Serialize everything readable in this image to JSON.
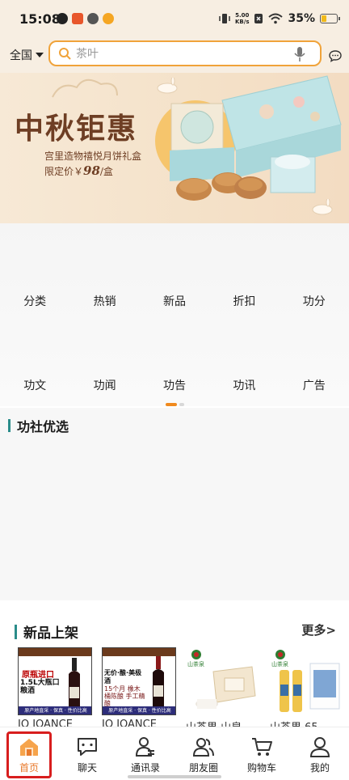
{
  "status_bar": {
    "time": "15:08",
    "net_speed_value": "5.00",
    "net_speed_unit": "KB/s",
    "battery_text": "35%",
    "battery_level": 0.35
  },
  "search": {
    "region": "全国",
    "placeholder": "茶叶"
  },
  "banner": {
    "title": "中秋钜惠",
    "subtitle": "宫里造物禧悦月饼礼盒",
    "price_prefix": "限定价￥",
    "price_value": "98",
    "price_suffix": "/盒"
  },
  "quick_menu": {
    "row1": [
      "分类",
      "热销",
      "新品",
      "折扣",
      "功分"
    ],
    "row2": [
      "功文",
      "功闻",
      "功告",
      "功讯",
      "广告"
    ]
  },
  "sections": {
    "gongshe_title": "功社优选",
    "new_title": "新品上架",
    "more_label": "更多>"
  },
  "products": [
    {
      "label_main": "原瓶进口",
      "label_sub": "1.5L大瓶口粮酒",
      "bottom": "原产地直采 · 保真 · 性价比高",
      "name": "IO JOANCE"
    },
    {
      "label_main": "无价·酿·美极酒",
      "label_sub": "15个月 橡木桶陈酿 手工精酿",
      "bottom": "原产地直采 · 保真 · 性价比高",
      "name": "IO JOANCE"
    },
    {
      "brand": "山茶泉",
      "name": "山茶果 山泉"
    },
    {
      "brand": "山茶泉",
      "name": "山茶果 65"
    }
  ],
  "tabbar": {
    "tabs": [
      {
        "label": "首页",
        "icon": "home-icon",
        "active": true
      },
      {
        "label": "聊天",
        "icon": "chat-icon",
        "active": false
      },
      {
        "label": "通讯录",
        "icon": "contacts-icon",
        "active": false
      },
      {
        "label": "朋友圈",
        "icon": "friends-icon",
        "active": false
      },
      {
        "label": "购物车",
        "icon": "cart-icon",
        "active": false
      },
      {
        "label": "我的",
        "icon": "profile-icon",
        "active": false
      }
    ]
  },
  "colors": {
    "accent": "#f0a33a",
    "active_tab": "#e8792b",
    "highlight": "#d81e1e",
    "section_bar": "#2a8c8a",
    "banner_text": "#6e3e24"
  }
}
